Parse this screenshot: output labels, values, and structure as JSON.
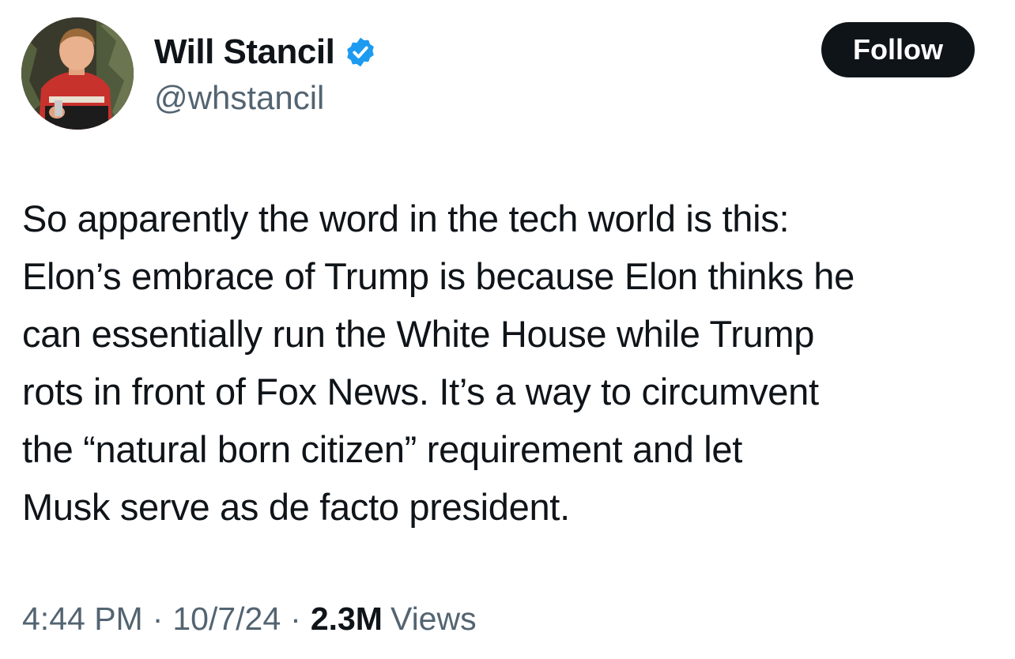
{
  "author": {
    "display_name": "Will Stancil",
    "handle": "@whstancil",
    "verified_icon": "verified-badge-icon",
    "badge_color": "#1d9bf0"
  },
  "actions": {
    "follow_label": "Follow"
  },
  "tweet": {
    "text": "So apparently the word in the tech world is this:\nElon’s embrace of Trump is because Elon thinks he\ncan essentially run the White House while Trump\nrots in front of Fox News. It’s a way to circumvent\nthe “natural born citizen” requirement and let\nMusk serve as de facto president."
  },
  "meta": {
    "time": "4:44 PM",
    "separator": "·",
    "date": "10/7/24",
    "views_count": "2.3M",
    "views_label": "Views"
  },
  "colors": {
    "text_primary": "#0f1419",
    "text_secondary": "#536471",
    "follow_bg": "#0f1419"
  }
}
